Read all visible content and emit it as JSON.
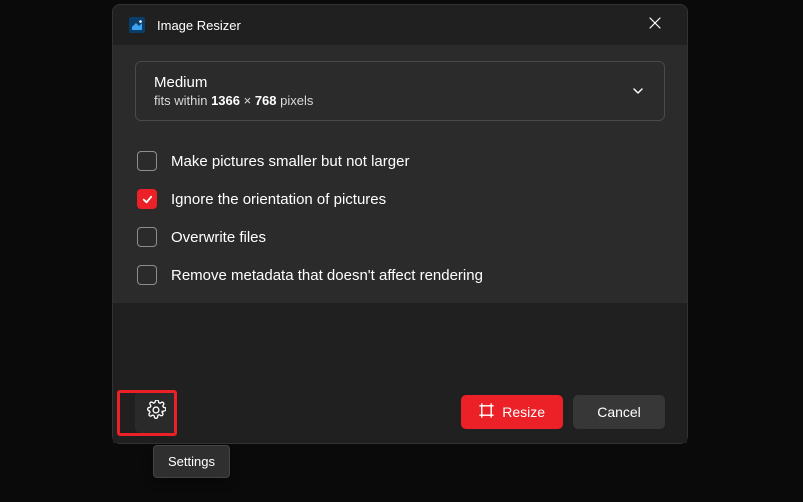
{
  "header": {
    "title": "Image Resizer"
  },
  "dropdown": {
    "name": "Medium",
    "prefix": "fits within ",
    "w": "1366",
    "x": " × ",
    "h": "768",
    "suffix": " pixels"
  },
  "checks": [
    {
      "label": "Make pictures smaller but not larger",
      "checked": false
    },
    {
      "label": "Ignore the orientation of pictures",
      "checked": true
    },
    {
      "label": "Overwrite files",
      "checked": false
    },
    {
      "label": "Remove metadata that doesn't affect rendering",
      "checked": false
    }
  ],
  "footer": {
    "resize": "Resize",
    "cancel": "Cancel"
  },
  "tooltip": {
    "settings": "Settings"
  },
  "colors": {
    "accent": "#eb2127"
  }
}
